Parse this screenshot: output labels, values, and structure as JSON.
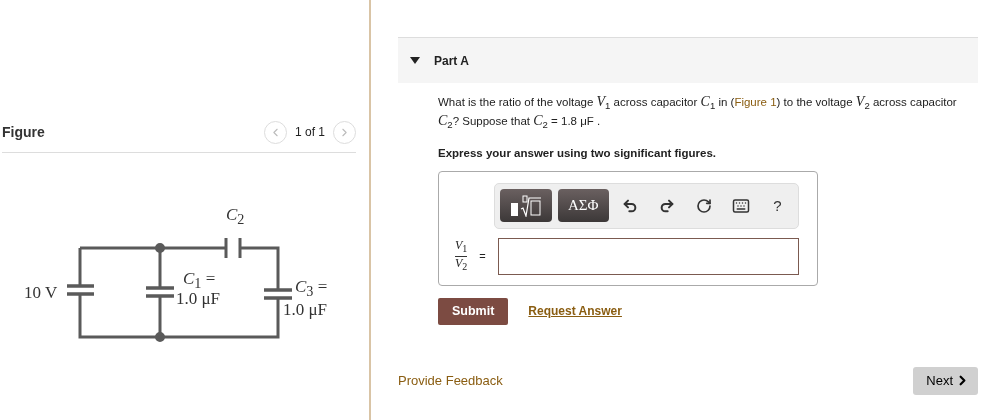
{
  "figure_panel": {
    "title": "Figure",
    "pager": "1 of 1",
    "circuit": {
      "source": "10 V",
      "c2": "*C*$_{2}$",
      "c1_name": "*C*$_{1}$ =",
      "c1_value": "1.0 μF",
      "c3_name": "*C*$_{3}$ =",
      "c3_value": "1.0 μF"
    }
  },
  "part": {
    "title": "Part A",
    "expanded": true,
    "question": {
      "before": "What is the ratio of the voltage *V*$_{1}$ across capacitor *C*$_{1}$ in (",
      "link": "Figure 1",
      "after": ") to the voltage *V*$_{2}$ across capacitor *C*$_{2}$? Suppose that *C*$_{2}$ = 1.8 μF ."
    },
    "instruction": "Express your answer using two significant figures.",
    "toolbar": [
      {
        "kind": "template"
      },
      {
        "kind": "symbols",
        "label": "ΑΣΦ"
      },
      {
        "kind": "undo"
      },
      {
        "kind": "redo"
      },
      {
        "kind": "reset"
      },
      {
        "kind": "keyboard"
      },
      {
        "kind": "help",
        "label": "?"
      }
    ],
    "answer": {
      "numerator": "*V*$_{1}$",
      "denominator": "*V*$_{2}$",
      "equals": "="
    },
    "submit": "Submit",
    "request": "Request Answer"
  },
  "footer": {
    "feedback": "Provide Feedback",
    "next": "Next"
  }
}
